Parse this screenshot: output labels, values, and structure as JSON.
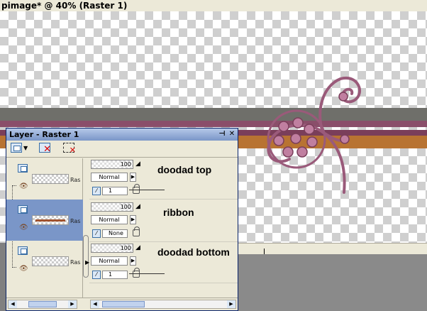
{
  "document": {
    "title": "pimage* @  40% (Raster 1)"
  },
  "palette": {
    "title": "Layer - Raster 1",
    "pin_icon": "pin-icon",
    "close_icon": "close-icon",
    "layers": [
      {
        "name": "Ras",
        "selected": false
      },
      {
        "name": "Ras",
        "selected": true
      },
      {
        "name": "Ras",
        "selected": false
      }
    ],
    "properties": [
      {
        "opacity": "100",
        "blend": "Normal",
        "group": "1",
        "annotation": "doodad top"
      },
      {
        "opacity": "100",
        "blend": "Normal",
        "group": "None",
        "annotation": "ribbon"
      },
      {
        "opacity": "100",
        "blend": "Normal",
        "group": "1",
        "annotation": "doodad bottom"
      }
    ]
  },
  "colors": {
    "ribbon_orange": "#b87332",
    "ribbon_mauve": "#8a4e6a",
    "doodad": "#9a5a7a",
    "selected_row": "#7a96c8"
  }
}
